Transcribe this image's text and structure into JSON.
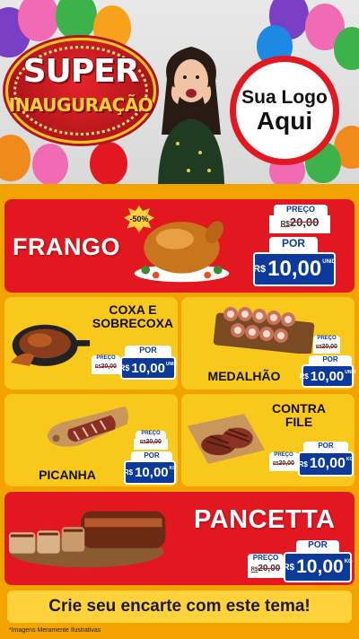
{
  "header": {
    "badge_top": "SUPER",
    "badge_bottom": "INAUGURAÇÃO",
    "logo_line1": "Sua Logo",
    "logo_line2": "Aqui"
  },
  "colors": {
    "red": "#e3171f",
    "yellow": "#f8c81b",
    "blue": "#0b3a9c",
    "orange_bg": "#f2a300"
  },
  "products": {
    "frango": {
      "name": "FRANGO",
      "discount": "-50%",
      "label_old": "PREÇO",
      "old_cur": "R$",
      "old_price": "20,00",
      "label_new": "POR",
      "new_cur": "R$",
      "new_price": "10,00",
      "unit": "UNID"
    },
    "coxa": {
      "name_line1": "COXA E",
      "name_line2": "SOBRECOXA",
      "label_old": "PREÇO",
      "old_cur": "R$",
      "old_price": "20,00",
      "label_new": "POR",
      "new_cur": "R$",
      "new_price": "10,00",
      "unit": "UNID"
    },
    "medalhao": {
      "name": "MEDALHÃO",
      "label_old": "PREÇO",
      "old_cur": "R$",
      "old_price": "20,00",
      "label_new": "POR",
      "new_cur": "R$",
      "new_price": "10,00",
      "unit": "UNID"
    },
    "picanha": {
      "name": "PICANHA",
      "label_old": "PREÇO",
      "old_cur": "R$",
      "old_price": "20,00",
      "label_new": "POR",
      "new_cur": "R$",
      "new_price": "10,00",
      "unit": "KG"
    },
    "contrafile": {
      "name_line1": "CONTRA",
      "name_line2": "FILE",
      "label_old": "PREÇO",
      "old_cur": "R$",
      "old_price": "20,00",
      "label_new": "POR",
      "new_cur": "R$",
      "new_price": "10,00",
      "unit": "KG"
    },
    "pancetta": {
      "name": "PANCETTA",
      "label_old": "PREÇO",
      "old_cur": "R$",
      "old_price": "20,00",
      "label_new": "POR",
      "new_cur": "R$",
      "new_price": "10,00",
      "unit": "KG"
    }
  },
  "footer": {
    "cta": "Crie seu encarte com este tema!",
    "disclaimer": "*Imagens Meramente Ilustrativas"
  }
}
